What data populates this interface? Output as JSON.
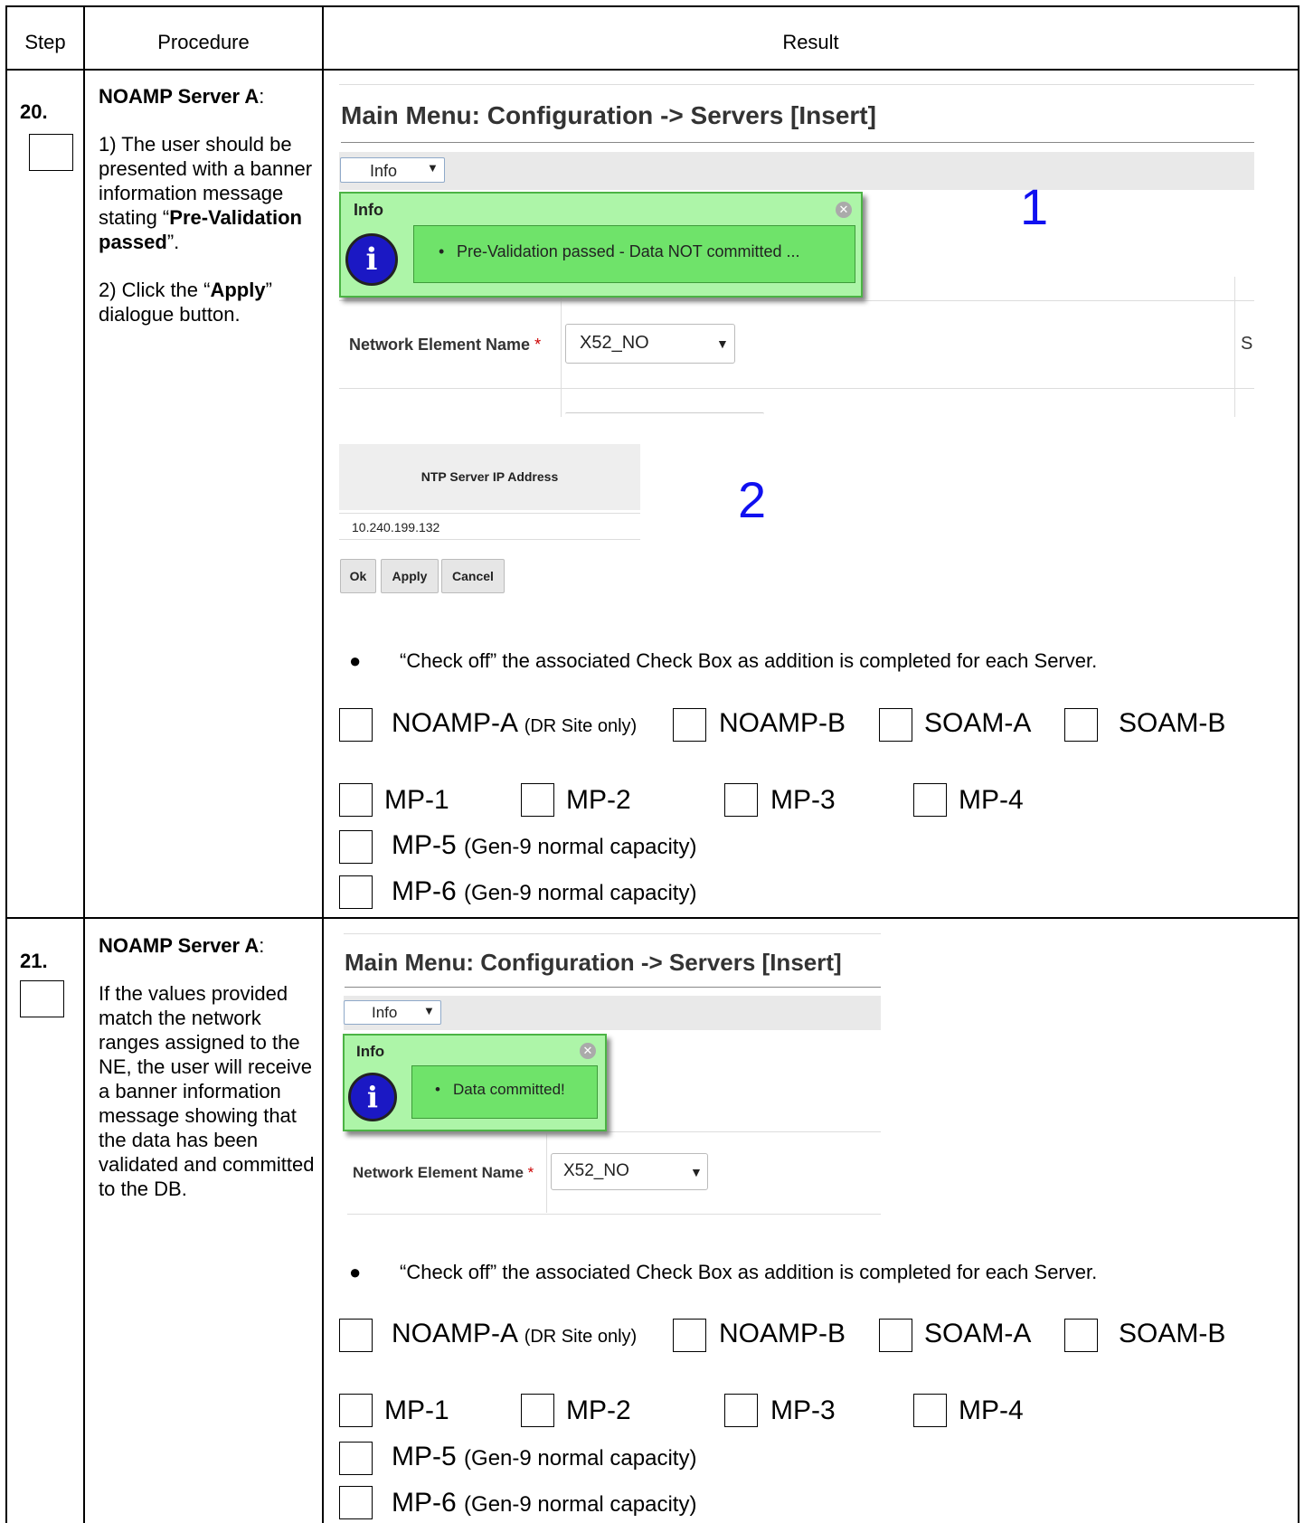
{
  "header": {
    "step": "Step",
    "procedure": "Procedure",
    "result": "Result"
  },
  "rows": [
    {
      "step": "20.",
      "proc_title": "NOAMP Server A",
      "proc_p1_a": "1) The user should be presented with a banner information message stating “",
      "proc_p1_b": "Pre-Validation passed",
      "proc_p1_c": "”.",
      "proc_p2_a": "2) Click the “",
      "proc_p2_b": "Apply",
      "proc_p2_c": "” dialogue button.",
      "screen_title": "Main Menu: Configuration -> Servers [Insert]",
      "info_button": "Info",
      "info_panel_title": "Info",
      "info_message": "Pre-Validation passed - Data NOT committed ...",
      "callout_1": "1",
      "ne_label": "Network Element Name",
      "ne_value": "X52_NO",
      "cut_off_text": "S",
      "ntp_header": "NTP Server IP Address",
      "ntp_value": "10.240.199.132",
      "callout_2": "2",
      "buttons": {
        "ok": "Ok",
        "apply": "Apply",
        "cancel": "Cancel"
      }
    },
    {
      "step": "21.",
      "proc_title": "NOAMP Server A",
      "proc_text": "If the values provided match the network ranges assigned to the NE, the user will receive a banner information message showing that the data has been validated and committed to the DB.",
      "screen_title": "Main Menu: Configuration -> Servers [Insert]",
      "info_button": "Info",
      "info_panel_title": "Info",
      "info_message": "Data committed!",
      "ne_label": "Network Element Name",
      "ne_value": "X52_NO"
    }
  ],
  "checklist": {
    "instruction": "“Check off” the associated Check Box as addition is completed for each Server.",
    "noamp_a": "NOAMP-A",
    "dr_note": "(DR Site only)",
    "noamp_b": "NOAMP-B",
    "soam_a": "SOAM-A",
    "soam_b": "SOAM-B",
    "mp1": "MP-1",
    "mp2": "MP-2",
    "mp3": "MP-3",
    "mp4": "MP-4",
    "mp5": "MP-5",
    "mp6": "MP-6",
    "gen_note": "(Gen-9 normal capacity)"
  },
  "colors": {
    "info_bg": "#adf5a8",
    "info_msg_bg": "#6fe36a",
    "callout": "#1010f0",
    "info_icon": "#1b18c4"
  }
}
